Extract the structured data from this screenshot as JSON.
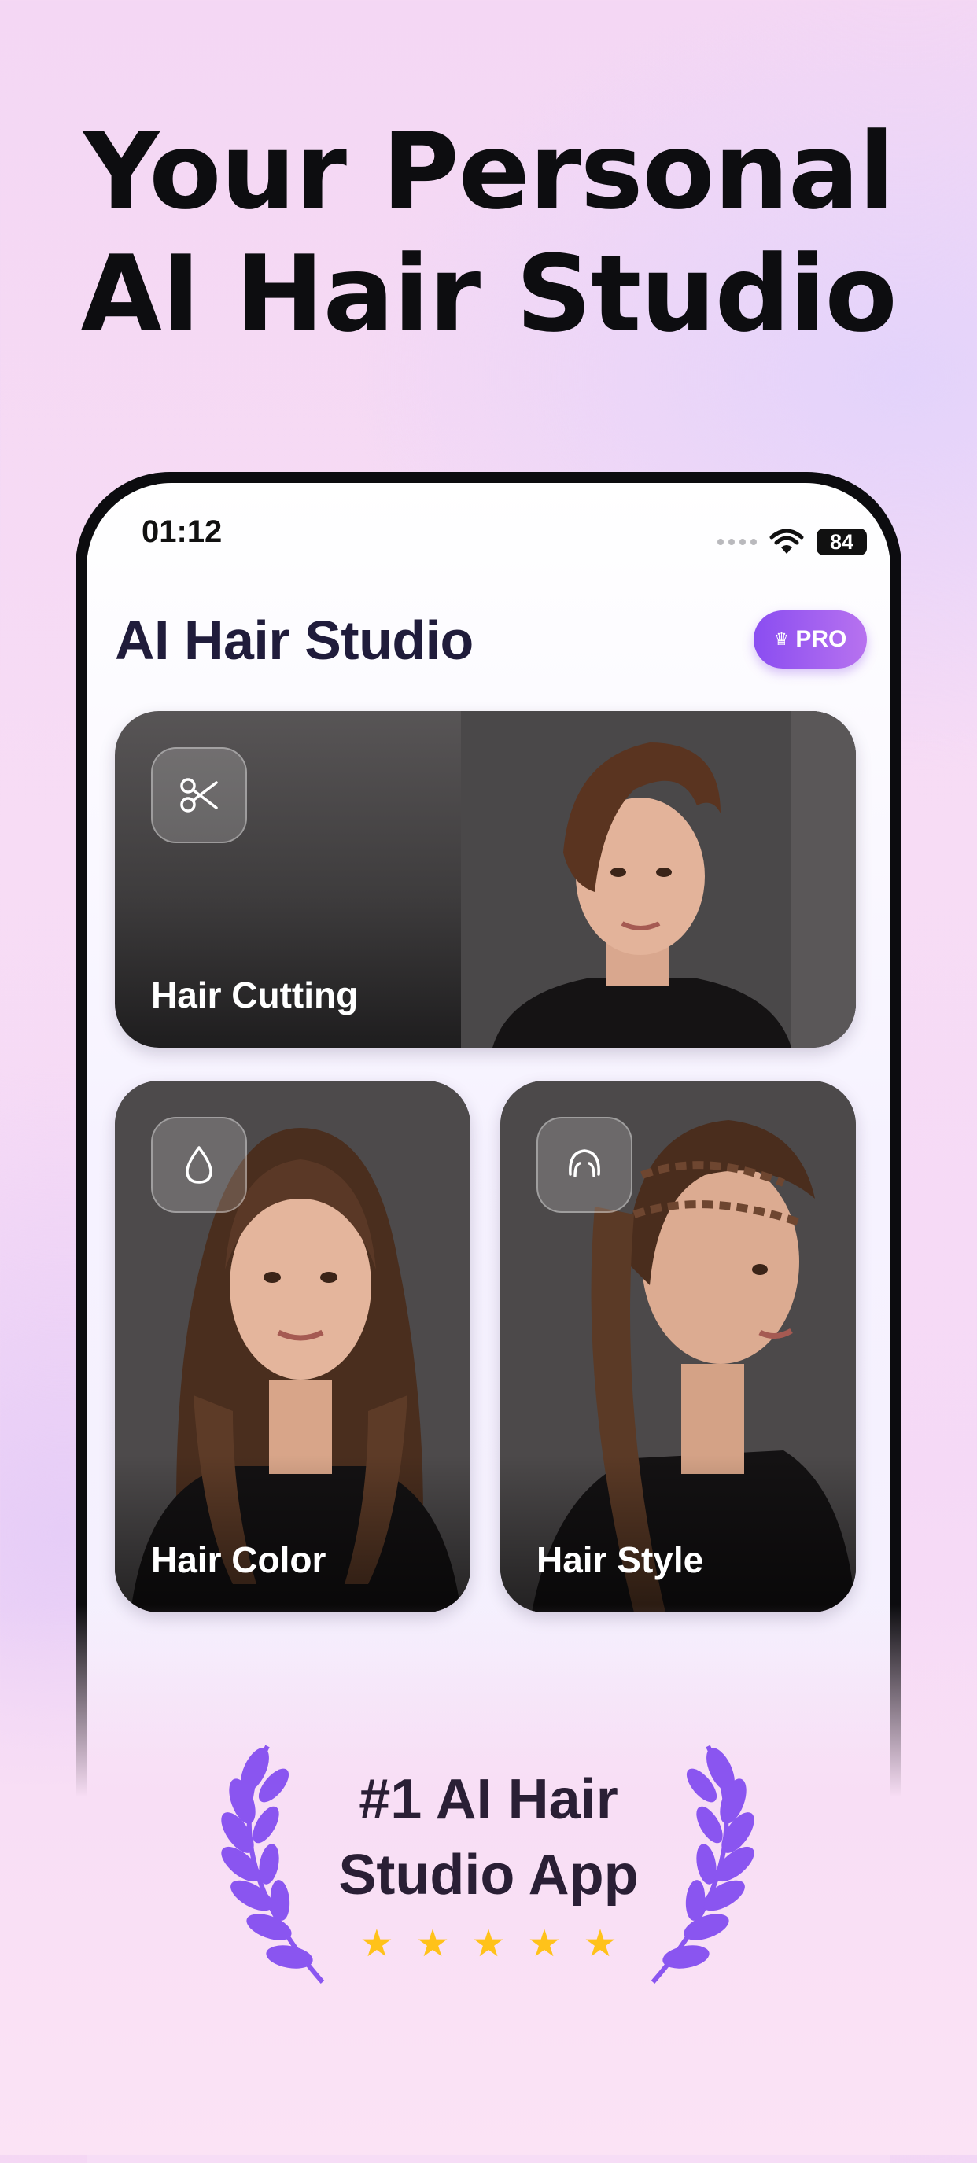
{
  "headline": {
    "line1": "Your Personal",
    "line2": "AI Hair Studio"
  },
  "status_bar": {
    "time": "01:12",
    "battery": "84",
    "icons": [
      "signal-dots-icon",
      "wifi-icon",
      "battery-icon"
    ]
  },
  "app": {
    "title": "AI Hair Studio",
    "pro_label": "PRO",
    "pro_icon": "crown-icon",
    "accent": "#8a4df1"
  },
  "cards": [
    {
      "label": "Hair Cutting",
      "icon": "scissors-icon"
    },
    {
      "label": "Hair Color",
      "icon": "droplet-icon"
    },
    {
      "label": "Hair Style",
      "icon": "hairstyle-icon"
    }
  ],
  "award": {
    "line1": "#1 AI Hair",
    "line2": "Studio App",
    "rating_stars": 5,
    "laurel_color": "#8a55f0",
    "star_color": "#ffc21a"
  }
}
